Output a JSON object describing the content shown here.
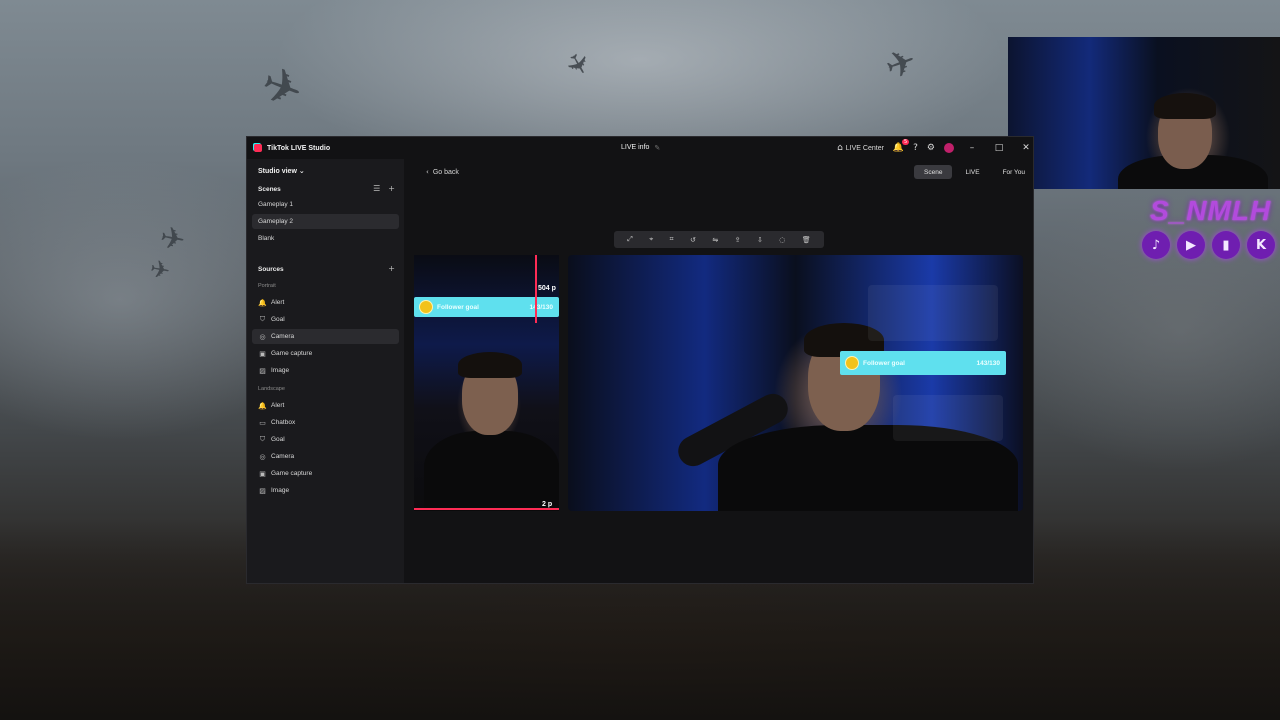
{
  "app": {
    "title": "TikTok LIVE Studio",
    "center_title": "LIVE info",
    "live_center_label": "LIVE Center",
    "notification_count": "5"
  },
  "sidebar": {
    "studio_view": "Studio view",
    "scenes_header": "Scenes",
    "scenes": [
      {
        "label": "Gameplay 1",
        "selected": false
      },
      {
        "label": "Gameplay 2",
        "selected": true
      },
      {
        "label": "Blank",
        "selected": false
      }
    ],
    "sources_header": "Sources",
    "portrait_label": "Portrait",
    "portrait_sources": [
      {
        "label": "Alert",
        "icon": "bell-icon"
      },
      {
        "label": "Goal",
        "icon": "shield-icon"
      },
      {
        "label": "Camera",
        "icon": "camera-icon",
        "selected": true
      },
      {
        "label": "Game capture",
        "icon": "gamepad-icon"
      },
      {
        "label": "Image",
        "icon": "image-icon"
      }
    ],
    "landscape_label": "Landscape",
    "landscape_sources": [
      {
        "label": "Alert",
        "icon": "bell-icon"
      },
      {
        "label": "Chatbox",
        "icon": "chat-icon"
      },
      {
        "label": "Goal",
        "icon": "shield-icon"
      },
      {
        "label": "Camera",
        "icon": "camera-icon"
      },
      {
        "label": "Game capture",
        "icon": "gamepad-icon"
      },
      {
        "label": "Image",
        "icon": "image-icon"
      }
    ]
  },
  "main": {
    "go_back": "Go back",
    "tabs": [
      {
        "label": "Scene",
        "active": true
      },
      {
        "label": "LIVE",
        "active": false
      },
      {
        "label": "For You",
        "active": false
      }
    ],
    "portrait_preview": {
      "goal_label": "Follower goal",
      "goal_count": "143/130",
      "guide_top": "504 p",
      "guide_bottom": "2 p"
    },
    "landscape_preview": {
      "goal_label": "Follower goal",
      "goal_count": "143/130"
    }
  },
  "overlay": {
    "channel_name": "S_NMLH",
    "socials": [
      "tiktok-icon",
      "youtube-icon",
      "twitch-icon",
      "kick-icon"
    ],
    "accent_color": "#7a1fb0"
  }
}
